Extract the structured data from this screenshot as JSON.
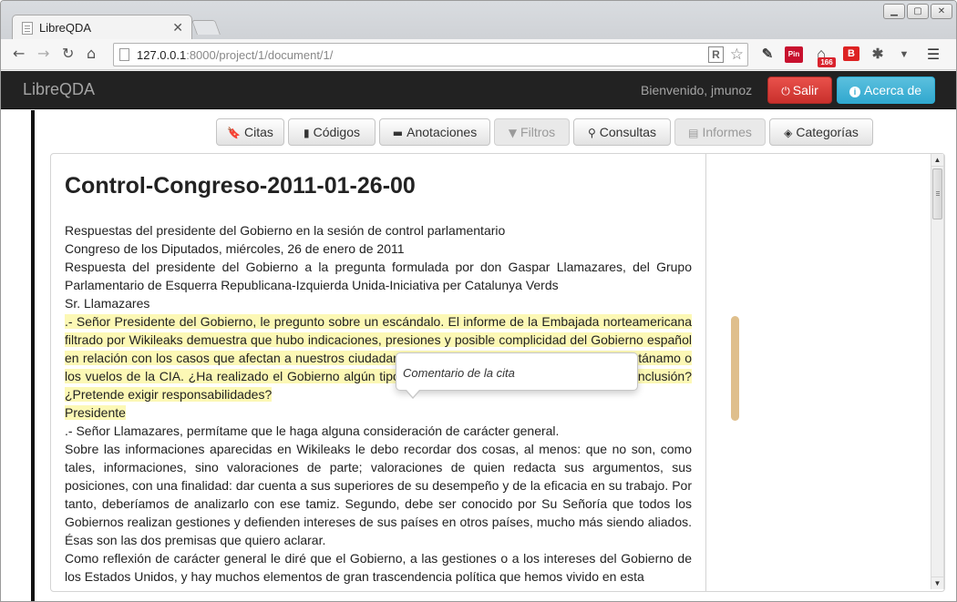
{
  "browser": {
    "tab_title": "LibreQDA",
    "url_host": "127.0.0.1",
    "url_rest": ":8000/project/1/document/1/",
    "ext_pin_label": "Pin",
    "ext_badge_count": "166",
    "ext_b_label": "B"
  },
  "navbar": {
    "brand": "LibreQDA",
    "welcome": "Bienvenido, jmunoz",
    "salir_label": "Salir",
    "acerca_label": "Acerca de"
  },
  "toolbar": {
    "citas": "Citas",
    "codigos": "Códigos",
    "anotaciones": "Anotaciones",
    "filtros": "Filtros",
    "consultas": "Consultas",
    "informes": "Informes",
    "categorias": "Categorías"
  },
  "document": {
    "title": "Control-Congreso-2011-01-26-00",
    "lines": [
      "Respuestas del presidente del Gobierno en la sesión de control parlamentario",
      "Congreso de los Diputados, miércoles, 26 de enero de 2011",
      "Respuesta del presidente del Gobierno a la pregunta formulada por don Gaspar Llamazares, del Grupo Parlamentario de Esquerra Republicana-Izquierda Unida-Iniciativa per Catalunya Verds",
      "Sr. Llamazares"
    ],
    "highlighted": ".- Señor Presidente del Gobierno, le pregunto sobre un escándalo. El informe de la Embajada norteamericana filtrado por Wikileaks demuestra que hubo indicaciones, presiones y posible complicidad del Gobierno español en relación con los casos que afectan a nuestros ciudadanos en España como Couso, el caso Guantánamo o los vuelos de la CIA. ¿Ha realizado el Gobierno algún tipo de investigación? ¿Ha sacado alguna conclusión? ¿Pretende exigir responsabilidades?",
    "speaker": "Presidente",
    "rest": [
      ".- Señor Llamazares, permítame que le haga alguna consideración de carácter general.",
      "Sobre las informaciones aparecidas en Wikileaks le debo recordar dos cosas, al menos: que no son, como tales, informaciones, sino valoraciones de parte; valoraciones de quien redacta sus argumentos, sus posiciones, con una finalidad: dar cuenta a sus superiores de su desempeño y de la eficacia en su trabajo. Por tanto, deberíamos de analizarlo con ese tamiz. Segundo, debe ser conocido por Su Señoría que todos los Gobiernos realizan gestiones y defienden intereses de sus países en otros países, mucho más siendo aliados. Ésas son las dos premisas que quiero aclarar.",
      "Como reflexión de carácter general le diré que el Gobierno, a las gestiones o a los intereses del Gobierno de los Estados Unidos, y hay muchos elementos de gran trascendencia política que hemos vivido en esta"
    ]
  },
  "popover": {
    "text": "Comentario de la cita"
  }
}
